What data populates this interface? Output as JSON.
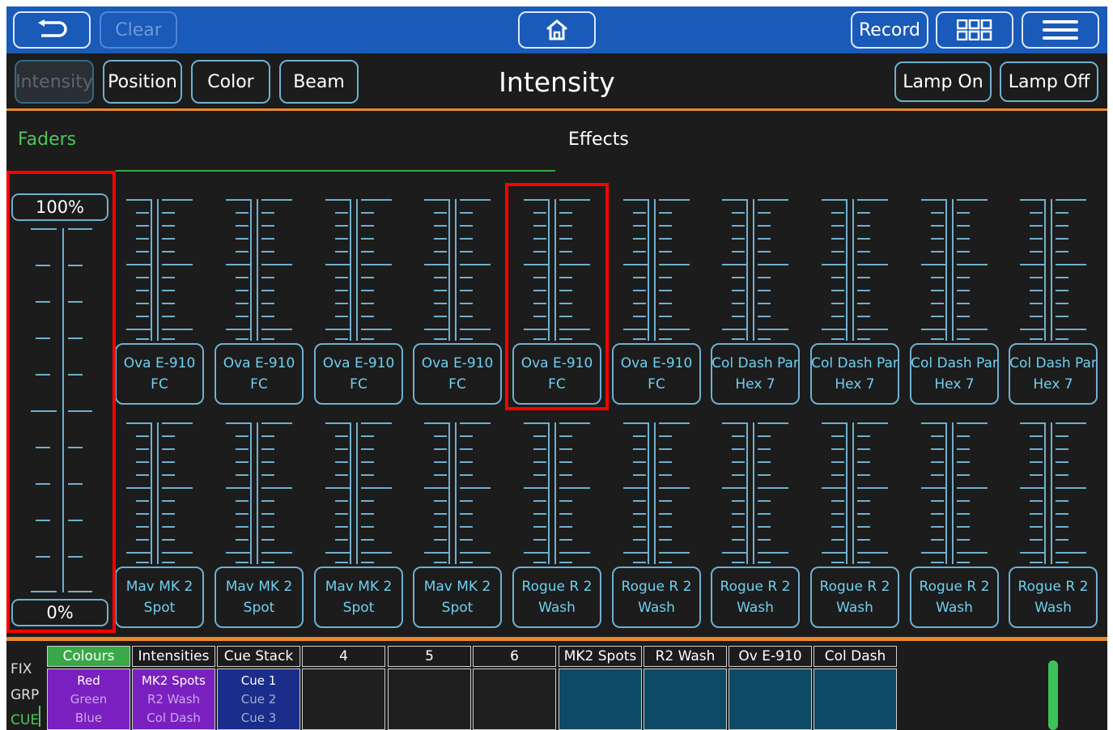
{
  "topbar": {
    "back_icon": "undo-arrow-icon",
    "clear_label": "Clear",
    "home_icon": "home-icon",
    "record_label": "Record",
    "grid_icon": "grid-icon",
    "menu_icon": "hamburger-menu-icon"
  },
  "modes": [
    "Intensity",
    "Position",
    "Color",
    "Beam"
  ],
  "page_title": "Intensity",
  "lamp": {
    "on_label": "Lamp On",
    "off_label": "Lamp Off"
  },
  "tabs": {
    "faders": "Faders",
    "effects": "Effects"
  },
  "master": {
    "top_label": "100%",
    "bottom_label": "0%"
  },
  "faders_row1": [
    {
      "line1": "Ova E-910",
      "line2": "FC"
    },
    {
      "line1": "Ova E-910",
      "line2": "FC"
    },
    {
      "line1": "Ova E-910",
      "line2": "FC"
    },
    {
      "line1": "Ova E-910",
      "line2": "FC"
    },
    {
      "line1": "Ova E-910",
      "line2": "FC"
    },
    {
      "line1": "Ova E-910",
      "line2": "FC"
    },
    {
      "line1": "Col Dash Par",
      "line2": "Hex 7"
    },
    {
      "line1": "Col Dash Par",
      "line2": "Hex 7"
    },
    {
      "line1": "Col Dash Par",
      "line2": "Hex 7"
    },
    {
      "line1": "Col Dash Par",
      "line2": "Hex 7"
    }
  ],
  "faders_row2": [
    {
      "line1": "Mav MK 2",
      "line2": "Spot"
    },
    {
      "line1": "Mav MK 2",
      "line2": "Spot"
    },
    {
      "line1": "Mav MK 2",
      "line2": "Spot"
    },
    {
      "line1": "Mav MK 2",
      "line2": "Spot"
    },
    {
      "line1": "Rogue R 2",
      "line2": "Wash"
    },
    {
      "line1": "Rogue R 2",
      "line2": "Wash"
    },
    {
      "line1": "Rogue R 2",
      "line2": "Wash"
    },
    {
      "line1": "Rogue R 2",
      "line2": "Wash"
    },
    {
      "line1": "Rogue R 2",
      "line2": "Wash"
    },
    {
      "line1": "Rogue R 2",
      "line2": "Wash"
    }
  ],
  "bottom": {
    "side_labels": [
      "FIX",
      "GRP",
      "CUE"
    ],
    "slots": [
      {
        "header": "Colours",
        "items": [
          "Red",
          "Green",
          "Blue"
        ],
        "header_bg": "#3aa848",
        "body_bg": "#7a1fc0"
      },
      {
        "header": "Intensities",
        "items": [
          "MK2 Spots",
          "R2 Wash",
          "Col Dash"
        ],
        "header_bg": "#1c1c1c",
        "body_bg": "#7a1fc0"
      },
      {
        "header": "Cue Stack",
        "items": [
          "Cue 1",
          "Cue 2",
          "Cue 3"
        ],
        "header_bg": "#1c1c1c",
        "body_bg": "#1a2d8a"
      },
      {
        "header": "4",
        "items": [],
        "header_bg": "#1c1c1c",
        "body_bg": "#1f1f1f"
      },
      {
        "header": "5",
        "items": [],
        "header_bg": "#1c1c1c",
        "body_bg": "#1f1f1f"
      },
      {
        "header": "6",
        "items": [],
        "header_bg": "#1c1c1c",
        "body_bg": "#1f1f1f"
      },
      {
        "header": "MK2 Spots",
        "items": [],
        "header_bg": "#1c1c1c",
        "body_bg": "#0d4a66"
      },
      {
        "header": "R2 Wash",
        "items": [],
        "header_bg": "#1c1c1c",
        "body_bg": "#0d4a66"
      },
      {
        "header": "Ov E-910",
        "items": [],
        "header_bg": "#1c1c1c",
        "body_bg": "#0d4a66"
      },
      {
        "header": "Col Dash",
        "items": [],
        "header_bg": "#1c1c1c",
        "body_bg": "#0d4a66"
      }
    ]
  },
  "colors": {
    "topbar": "#1a5ab8",
    "accent_orange": "#e8892c",
    "accent_green": "#4cc85a",
    "fader_line": "#6fb0cf",
    "highlight": "#ff0000"
  }
}
